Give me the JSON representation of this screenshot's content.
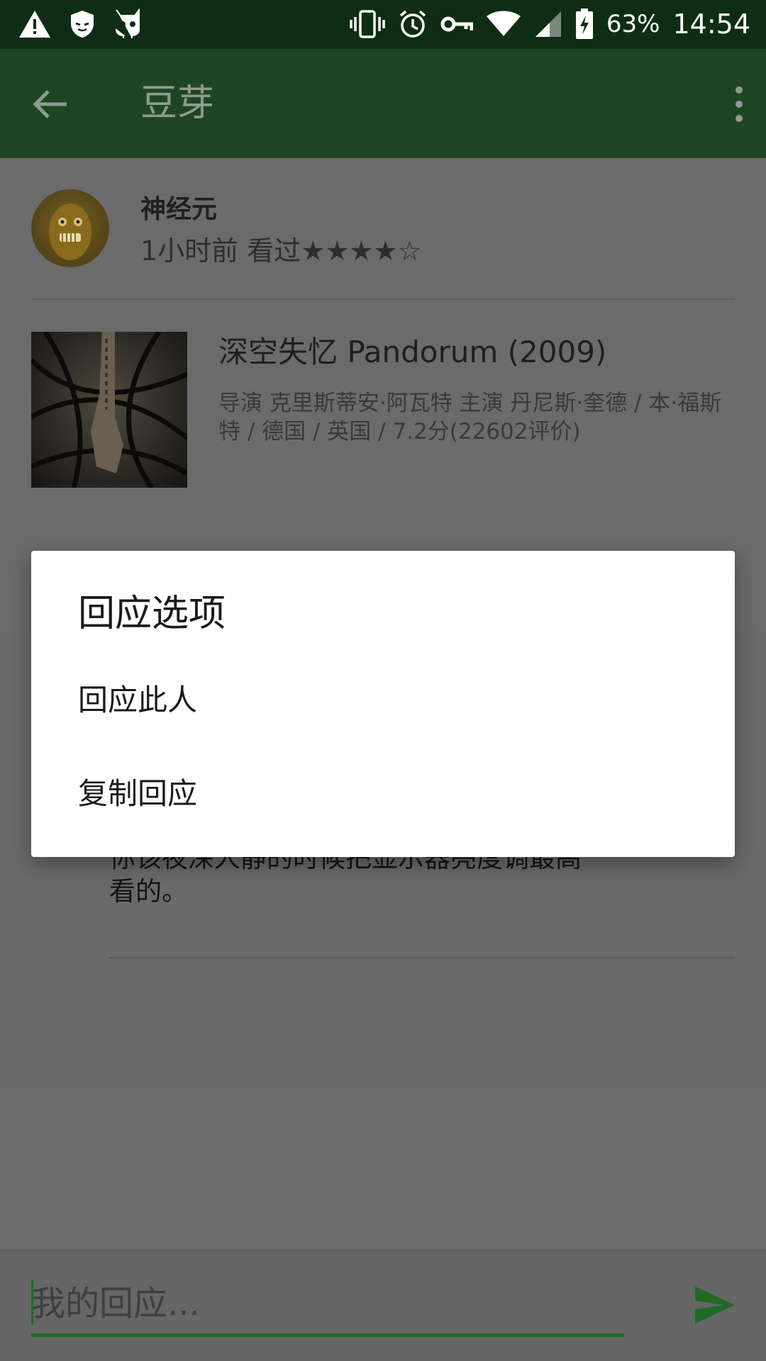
{
  "status_bar": {
    "battery_percent": "63%",
    "time": "14:54",
    "icons_left": [
      "warning-icon",
      "shield-icon",
      "cyanogen-icon"
    ],
    "icons_right": [
      "vibrate-icon",
      "alarm-icon",
      "vpn-key-icon",
      "wifi-icon",
      "signal-icon",
      "battery-charging-icon"
    ]
  },
  "app_bar": {
    "title": "豆芽",
    "back_icon": "arrow-back-icon",
    "menu_icon": "more-vert-icon"
  },
  "post": {
    "user_name": "神经元",
    "meta": "1小时前 看过★★★★☆",
    "rating_stars": 4
  },
  "movie": {
    "title": "深空失忆 Pandorum (2009)",
    "info": "导演 克里斯蒂安·阿瓦特 主演 丹尼斯·奎德 / 本·福斯特 / 德国 / 英国 / 7.2分(22602评价)"
  },
  "comment": {
    "text": "你该夜深人静的时候把显示器亮度调最高看的。"
  },
  "reply": {
    "placeholder": "我的回应...",
    "send_icon": "send-icon"
  },
  "dialog": {
    "title": "回应选项",
    "items": [
      "回应此人",
      "复制回应"
    ]
  },
  "colors": {
    "status_bar": "#0f2d14",
    "app_bar": "#1f4622",
    "accent": "#1d6b26",
    "scrim_content": "#6b6b6b",
    "dialog_bg": "#ffffff"
  }
}
